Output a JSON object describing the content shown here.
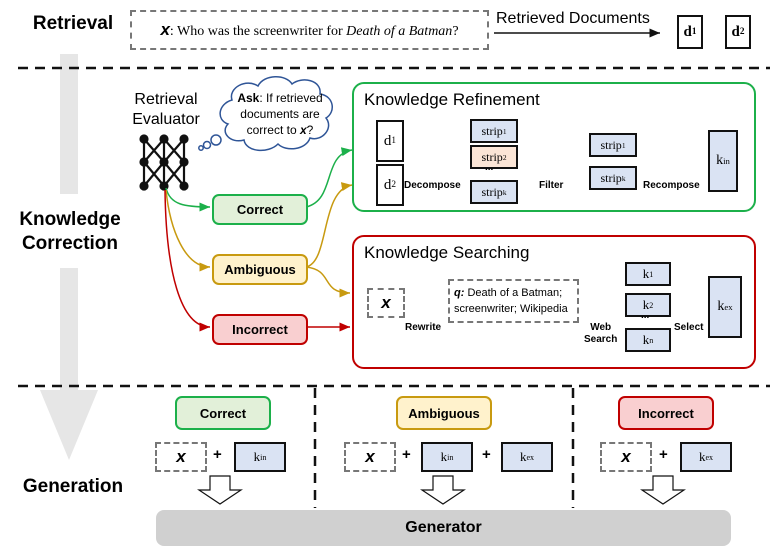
{
  "stages": {
    "retrieval": "Retrieval",
    "knowledge_correction_line1": "Knowledge",
    "knowledge_correction_line2": "Correction",
    "generation": "Generation"
  },
  "retrieval": {
    "query_var": "x",
    "query_text": ": Who was the screenwriter for ",
    "query_title": "Death of a Batman",
    "query_end": "?",
    "arrow_label": "Retrieved Documents",
    "docs": [
      {
        "base": "d",
        "sub": "1"
      },
      {
        "base": "d",
        "sub": "2"
      }
    ]
  },
  "evaluator": {
    "label_line1": "Retrieval",
    "label_line2": "Evaluator",
    "thought_bold": "Ask",
    "thought_line1": ": If retrieved",
    "thought_line2": "documents are",
    "thought_line3": "correct to ",
    "thought_var": "x",
    "thought_end": "?"
  },
  "actions": {
    "correct": "Correct",
    "ambiguous": "Ambiguous",
    "incorrect": "Incorrect"
  },
  "colors": {
    "correct_border": "#1cb04a",
    "correct_fill": "#e2f0d9",
    "ambiguous_border": "#c89a10",
    "ambiguous_fill": "#fff2cc",
    "incorrect_border": "#c00000",
    "incorrect_fill": "#f9cfd0",
    "strip_blue": "#dae3f3",
    "strip_orange": "#fbe5d6",
    "generator_fill": "#d0d0d0",
    "thought_border": "#2f5597"
  },
  "refinement": {
    "title": "Knowledge Refinement",
    "docs": [
      {
        "base": "d",
        "sub": "1"
      },
      {
        "base": "d",
        "sub": "2"
      }
    ],
    "decompose": "Decompose",
    "strips": [
      {
        "base": "strip",
        "sub": "1"
      },
      {
        "base": "strip",
        "sub": "2"
      },
      {
        "base": "strip",
        "sub": "k"
      }
    ],
    "ellipsis": "...",
    "filter": "Filter",
    "filtered": [
      {
        "base": "strip",
        "sub": "1"
      },
      {
        "base": "strip",
        "sub": "k"
      }
    ],
    "recompose": "Recompose",
    "output": {
      "base": "k",
      "sub": "in"
    }
  },
  "searching": {
    "title": "Knowledge Searching",
    "input_var": "x",
    "rewrite": "Rewrite",
    "query_label": "q:",
    "query_line1": " Death of a Batman;",
    "query_line2": "screenwriter; Wikipedia",
    "web_search_line1": "Web",
    "web_search_line2": "Search",
    "results": [
      {
        "base": "k",
        "sub": "1"
      },
      {
        "base": "k",
        "sub": "2"
      },
      {
        "base": "k",
        "sub": "n"
      }
    ],
    "ellipsis": "...",
    "select": "Select",
    "output": {
      "base": "k",
      "sub": "ex"
    }
  },
  "generation": {
    "columns": [
      {
        "action": "Correct",
        "inputs": [
          "x",
          "k_in"
        ]
      },
      {
        "action": "Ambiguous",
        "inputs": [
          "x",
          "k_in",
          "k_ex"
        ]
      },
      {
        "action": "Incorrect",
        "inputs": [
          "x",
          "k_ex"
        ]
      }
    ],
    "x_var": "x",
    "plus": "+",
    "k_in": {
      "base": "k",
      "sub": "in"
    },
    "k_ex": {
      "base": "k",
      "sub": "ex"
    },
    "generator": "Generator"
  }
}
